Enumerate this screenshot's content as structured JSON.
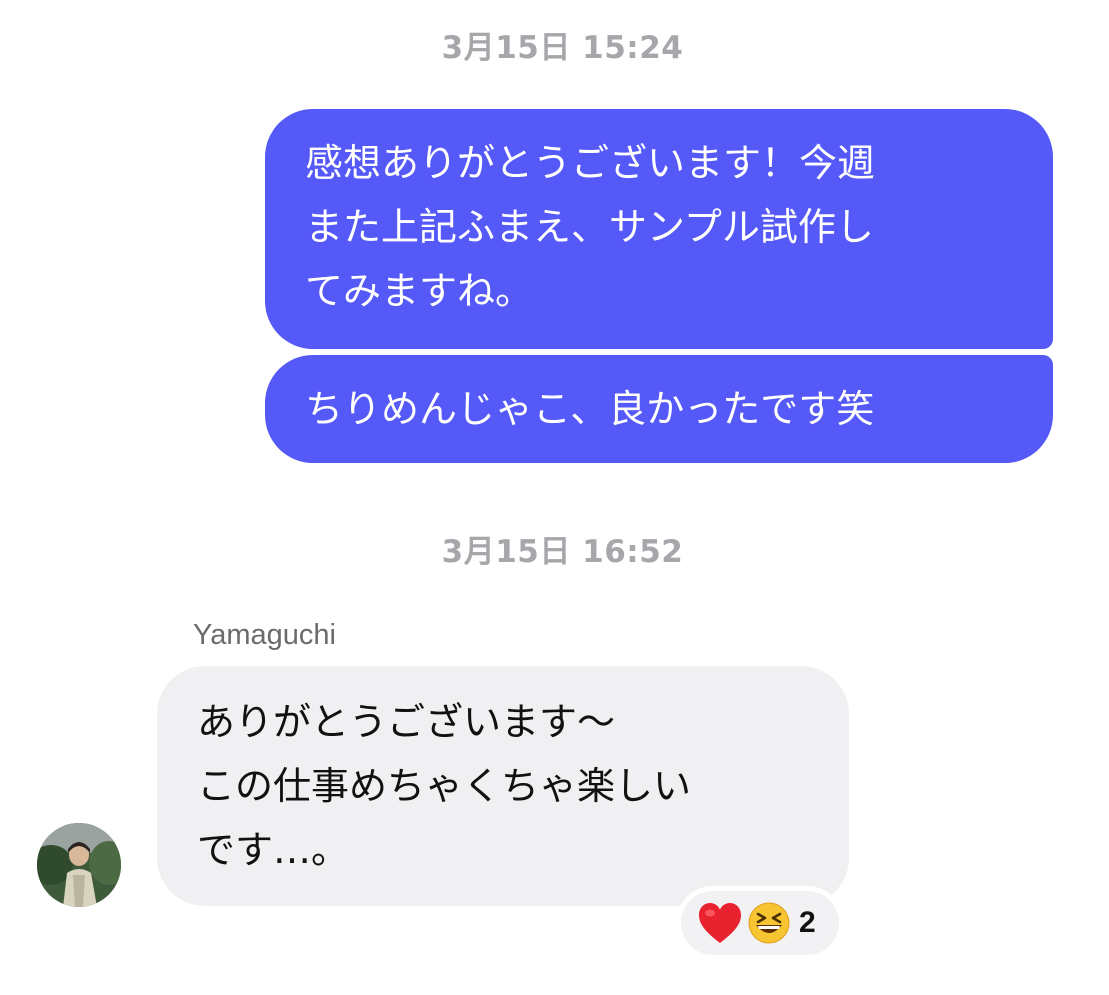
{
  "conversation": {
    "timestamps": [
      "3月15日 15:24",
      "3月15日 16:52"
    ],
    "outgoing_messages": [
      "感想ありがとうございます！今週\nまた上記ふまえ、サンプル試作し\nてみますね。",
      "ちりめんじゃこ、良かったです笑"
    ],
    "incoming": {
      "sender_name": "Yamaguchi",
      "message": "ありがとうございます〜\nこの仕事めちゃくちゃ楽しい\nです…。",
      "avatar_icon": "user-avatar-photo",
      "reactions": {
        "icons": [
          "red-heart-icon",
          "grinning-squinting-face-icon"
        ],
        "count": "2"
      }
    }
  },
  "colors": {
    "outgoing_bubble": "#5459f7",
    "incoming_bubble": "#f0f0f2",
    "timestamp_text": "#a6a6ab",
    "sender_name_text": "#6b6b6f"
  }
}
